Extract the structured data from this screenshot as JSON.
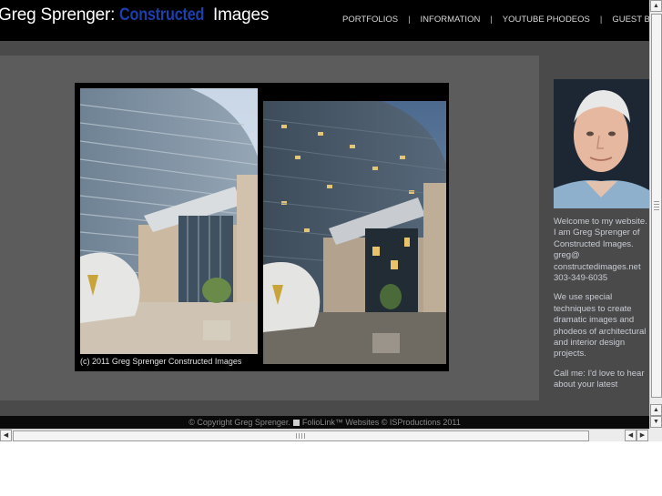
{
  "header": {
    "logo": {
      "prefix": "Greg Sprenger: ",
      "accent": "Constructed",
      "suffix": " Images"
    },
    "nav": [
      "PORTFOLIOS",
      "INFORMATION",
      "YOUTUBE PHODEOS",
      "GUEST BOOK"
    ],
    "separator": "|"
  },
  "gallery": {
    "caption": "(c) 2011 Greg Sprenger Constructed Images"
  },
  "sidebar": {
    "paragraphs": [
      "Welcome to my website.  I am Greg Sprenger of Constructed Images. greg@ constructedimages.net 303-349-6035",
      "We use special techniques to create dramatic images and phodeos of architectural and interior design projects.",
      "Call me: I'd love to hear about your latest"
    ]
  },
  "footer": {
    "left": "© Copyright Greg Sprenger.",
    "right": "FolioLink™ Websites © ISProductions 2011"
  },
  "colors": {
    "accent": "#1a3fae",
    "page_bg": "#4a4a4a",
    "stage_bg": "#5c5c5c",
    "header_bg": "#000000"
  }
}
